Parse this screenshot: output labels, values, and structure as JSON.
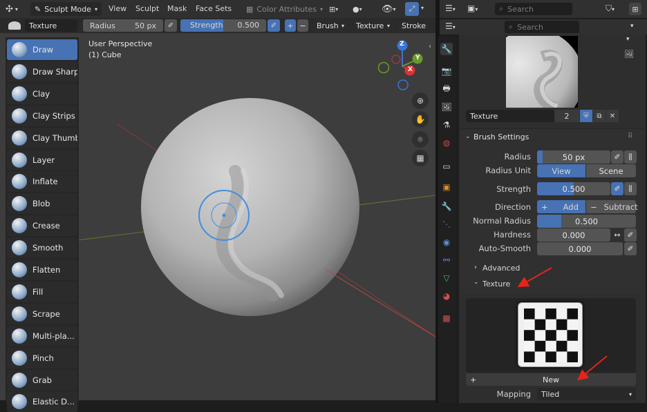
{
  "topbar": {
    "mode": "Sculpt Mode",
    "menus": [
      "View",
      "Sculpt",
      "Mask",
      "Face Sets"
    ],
    "color_attributes": "Color Attributes"
  },
  "toolsettings": {
    "brush_name": "Texture",
    "radius_label": "Radius",
    "radius_value": "50 px",
    "strength_label": "Strength",
    "strength_value": "0.500",
    "plus": "+",
    "minus": "−",
    "brush_dd": "Brush",
    "texture_dd": "Texture",
    "stroke_dd": "Stroke"
  },
  "viewport": {
    "perspective": "User Perspective",
    "object": "(1) Cube",
    "gizmo": {
      "z": "Z",
      "y": "Y",
      "x": "X"
    }
  },
  "tools": [
    {
      "label": "Draw",
      "active": true
    },
    {
      "label": "Draw Sharp"
    },
    {
      "label": "Clay"
    },
    {
      "label": "Clay Strips"
    },
    {
      "label": "Clay Thumb"
    },
    {
      "label": "Layer"
    },
    {
      "label": "Inflate"
    },
    {
      "label": "Blob"
    },
    {
      "label": "Crease"
    },
    {
      "label": "Smooth"
    },
    {
      "label": "Flatten"
    },
    {
      "label": "Fill"
    },
    {
      "label": "Scrape"
    },
    {
      "label": "Multi-pla..."
    },
    {
      "label": "Pinch"
    },
    {
      "label": "Grab"
    },
    {
      "label": "Elastic D..."
    }
  ],
  "outliner": {
    "search_placeholder": "Search"
  },
  "properties": {
    "search_placeholder": "Search",
    "brush_datablock": {
      "name": "Texture",
      "users": "2"
    },
    "brush_settings": {
      "title": "Brush Settings",
      "radius_label": "Radius",
      "radius_value": "50 px",
      "radius_unit_label": "Radius Unit",
      "radius_unit_view": "View",
      "radius_unit_scene": "Scene",
      "strength_label": "Strength",
      "strength_value": "0.500",
      "direction_label": "Direction",
      "direction_add": "Add",
      "direction_subtract": "Subtract",
      "normal_radius_label": "Normal Radius",
      "normal_radius_value": "0.500",
      "hardness_label": "Hardness",
      "hardness_value": "0.000",
      "autosmooth_label": "Auto-Smooth",
      "autosmooth_value": "0.000"
    },
    "advanced_title": "Advanced",
    "texture_title": "Texture",
    "new_button": "New",
    "mapping_label": "Mapping",
    "mapping_value": "Tiled"
  },
  "colors": {
    "accent": "#4772b3",
    "annotation": "#e8231c",
    "brush_circle": "#3f8fe0"
  }
}
